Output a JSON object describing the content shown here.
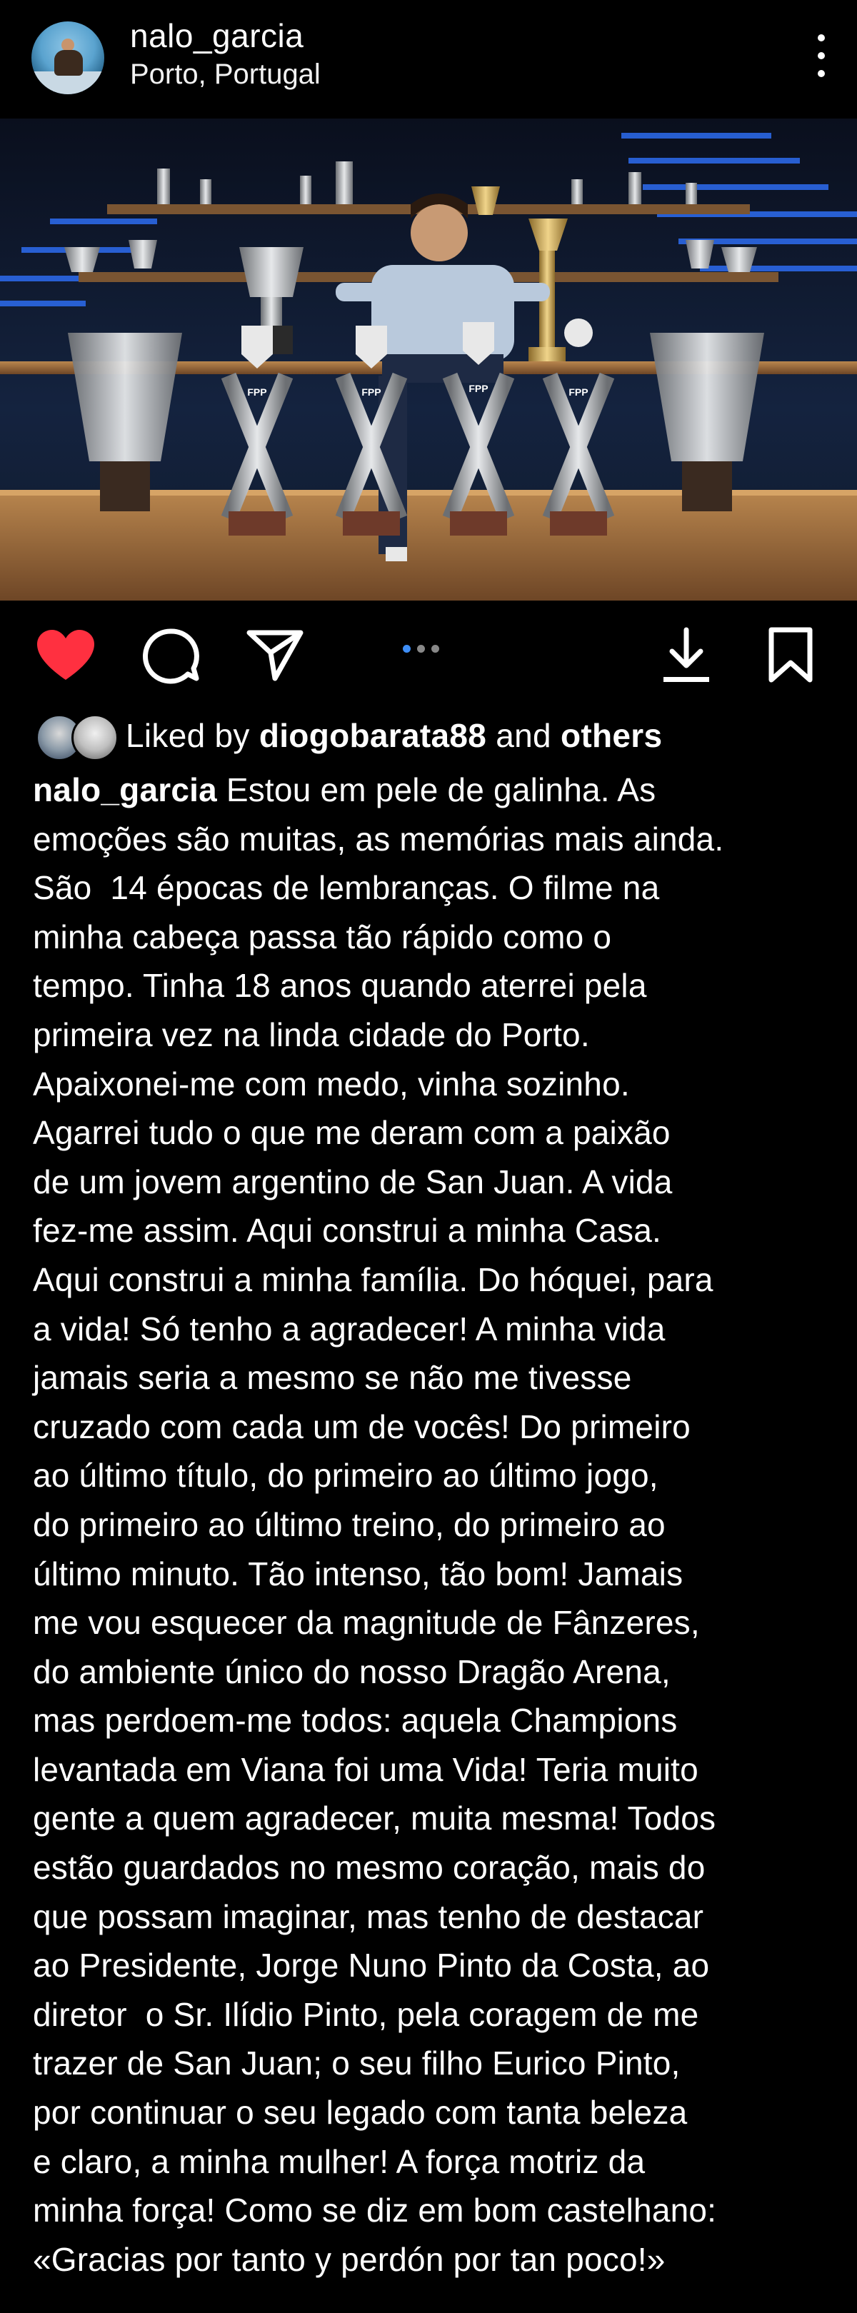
{
  "post": {
    "username": "nalo_garcia",
    "location": "Porto, Portugal",
    "avatar_icon": "profile-avatar",
    "more_icon": "more-vertical-icon"
  },
  "actions": {
    "like_icon": "heart-filled-icon",
    "comment_icon": "comment-icon",
    "share_icon": "send-icon",
    "download_icon": "download-icon",
    "save_icon": "bookmark-icon",
    "carousel_total": 3,
    "carousel_active": 1,
    "like_color": "#ff3040",
    "indicator_color": "#3e8ef7"
  },
  "likes": {
    "prefix": "Liked by",
    "user": "diogobarata88",
    "and": "and",
    "others": "others"
  },
  "caption": {
    "username": "nalo_garcia",
    "lines": [
      " Estou em pele de galinha. As",
      "emoções são muitas, as memórias mais ainda.",
      "São  14 épocas de lembranças. O filme na",
      "minha cabeça passa tão rápido como o",
      "tempo. Tinha 18 anos quando aterrei pela",
      "primeira vez na linda cidade do Porto.",
      "Apaixonei-me com medo, vinha sozinho.",
      "Agarrei tudo o que me deram com a paixão",
      "de um jovem argentino de San Juan. A vida",
      "fez-me assim. Aqui construi a minha Casa.",
      "Aqui construi a minha família. Do hóquei, para",
      "a vida! Só tenho a agradecer! A minha vida",
      "jamais seria a mesmo se não me tivesse",
      "cruzado com cada um de vocês! Do primeiro",
      "ao último título, do primeiro ao último jogo,",
      "do primeiro ao último treino, do primeiro ao",
      "último minuto. Tão intenso, tão bom! Jamais",
      "me vou esquecer da magnitude de Fânzeres,",
      "do ambiente único do nosso Dragão Arena,",
      "mas perdoem-me todos: aquela Champions",
      "levantada em Viana foi uma Vida! Teria muito",
      "gente a quem agradecer, muita mesma! Todos",
      "estão guardados no mesmo coração, mais do",
      "que possam imaginar, mas tenho de destacar",
      "ao Presidente, Jorge Nuno Pinto da Costa, ao",
      "diretor  o Sr. Ilídio Pinto, pela coragem de me",
      "trazer de San Juan; o seu filho Eurico Pinto,",
      "por continuar o seu legado com tanta beleza",
      "e claro, a minha mulher! A força motriz da",
      "minha força! Como se diz em bom castelhano:",
      "«Gracias por tanto y perdón por tan poco!»"
    ]
  },
  "photo": {
    "trophy_labels": [
      "FPP",
      "FPP",
      "FPP",
      "FPP"
    ]
  }
}
